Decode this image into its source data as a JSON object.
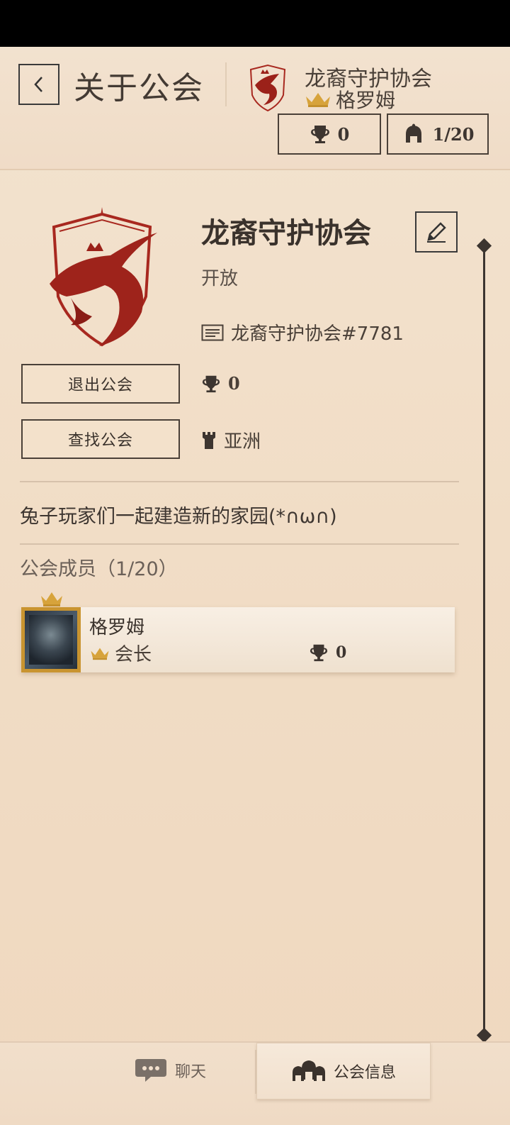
{
  "header": {
    "title": "关于公会",
    "guild_name": "龙裔守护协会",
    "leader_name": "格罗姆",
    "trophy_count": "0",
    "member_count": "1/20"
  },
  "guild": {
    "name": "龙裔守护协会",
    "status": "开放",
    "tag": "龙裔守护协会#7781",
    "trophies": "0",
    "region": "亚洲",
    "description": "兔子玩家们一起建造新的家园(*∩ω∩)"
  },
  "actions": {
    "leave": "退出公会",
    "find": "查找公会"
  },
  "members": {
    "title": "公会成员（1/20）",
    "list": [
      {
        "name": "格罗姆",
        "role": "会长",
        "trophies": "0"
      }
    ]
  },
  "tabs": {
    "chat": "聊天",
    "info": "公会信息"
  },
  "colors": {
    "accent_red": "#a8281f",
    "crown_gold": "#d7a33b",
    "text_dark": "#3a322c",
    "paper": "#f2e0cb"
  }
}
